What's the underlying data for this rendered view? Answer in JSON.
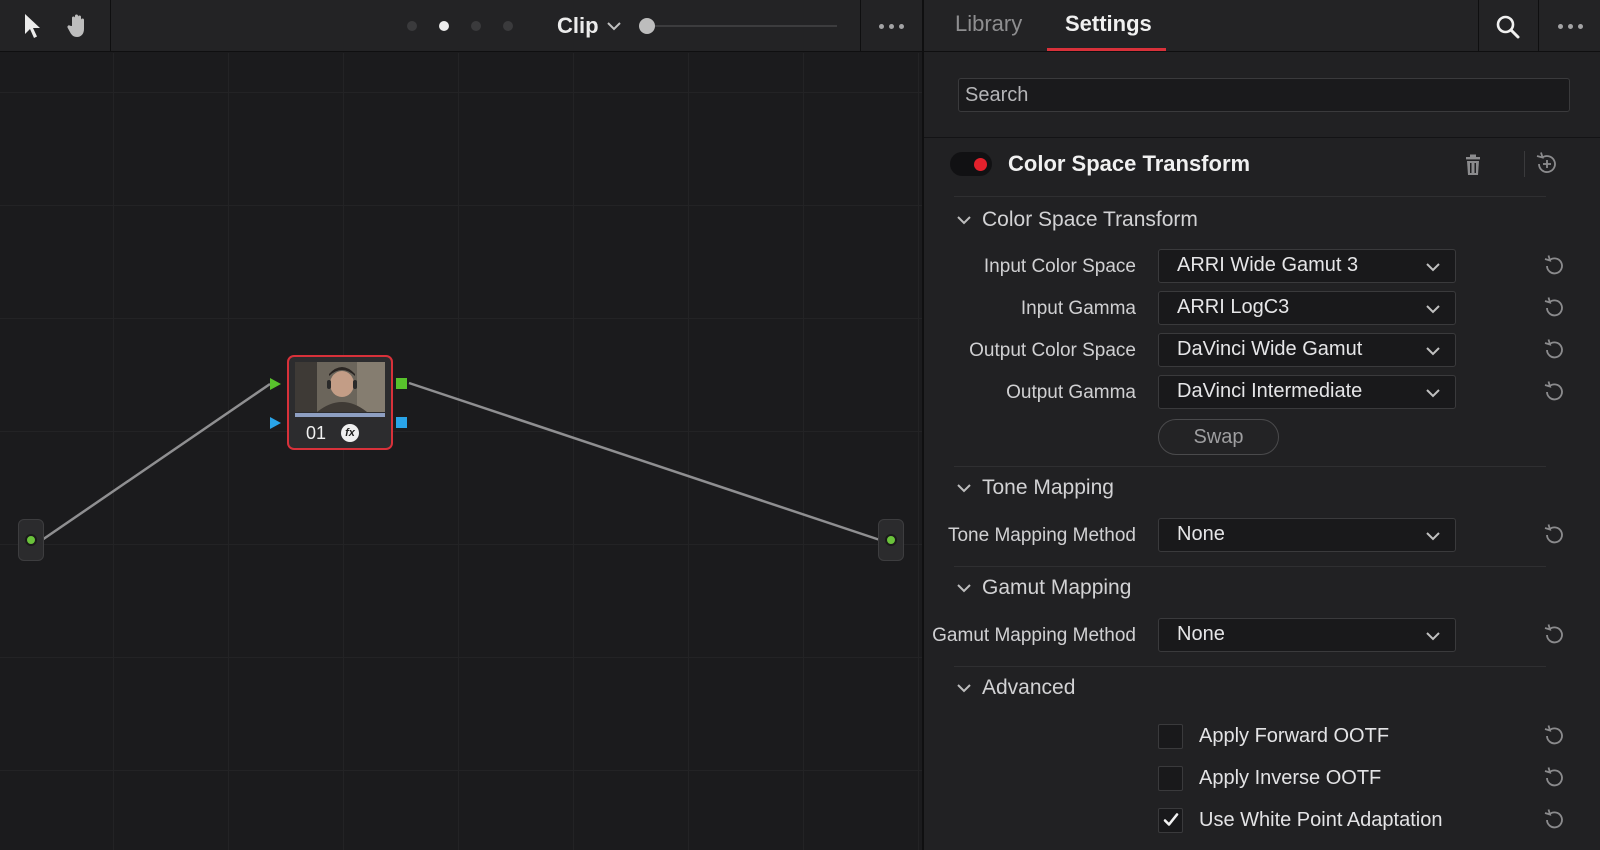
{
  "node_editor": {
    "toolbar": {
      "tools": [
        "pointer-tool",
        "hand-tool"
      ],
      "pages": [
        false,
        true,
        false,
        false
      ],
      "mode_label": "Clip"
    },
    "node": {
      "number": "01",
      "fx_badge": "fx"
    }
  },
  "inspector": {
    "tabs": {
      "library": "Library",
      "settings": "Settings"
    },
    "search": {
      "placeholder": "Search"
    },
    "effect": {
      "title": "Color Space Transform",
      "enabled_color": "#e3212c"
    },
    "sections": {
      "cst": {
        "title": "Color Space Transform",
        "fields": [
          {
            "label": "Input Color Space",
            "value": "ARRI Wide Gamut 3"
          },
          {
            "label": "Input Gamma",
            "value": "ARRI LogC3"
          },
          {
            "label": "Output Color Space",
            "value": "DaVinci Wide Gamut"
          },
          {
            "label": "Output Gamma",
            "value": "DaVinci Intermediate"
          }
        ],
        "swap_label": "Swap"
      },
      "tone": {
        "title": "Tone Mapping",
        "fields": [
          {
            "label": "Tone Mapping Method",
            "value": "None"
          }
        ]
      },
      "gamut": {
        "title": "Gamut Mapping",
        "fields": [
          {
            "label": "Gamut Mapping Method",
            "value": "None"
          }
        ]
      },
      "advanced": {
        "title": "Advanced",
        "checks": [
          {
            "label": "Apply Forward OOTF",
            "checked": false
          },
          {
            "label": "Apply Inverse OOTF",
            "checked": false
          },
          {
            "label": "Use White Point Adaptation",
            "checked": true
          }
        ]
      }
    },
    "accent_color": "#d8313a"
  }
}
